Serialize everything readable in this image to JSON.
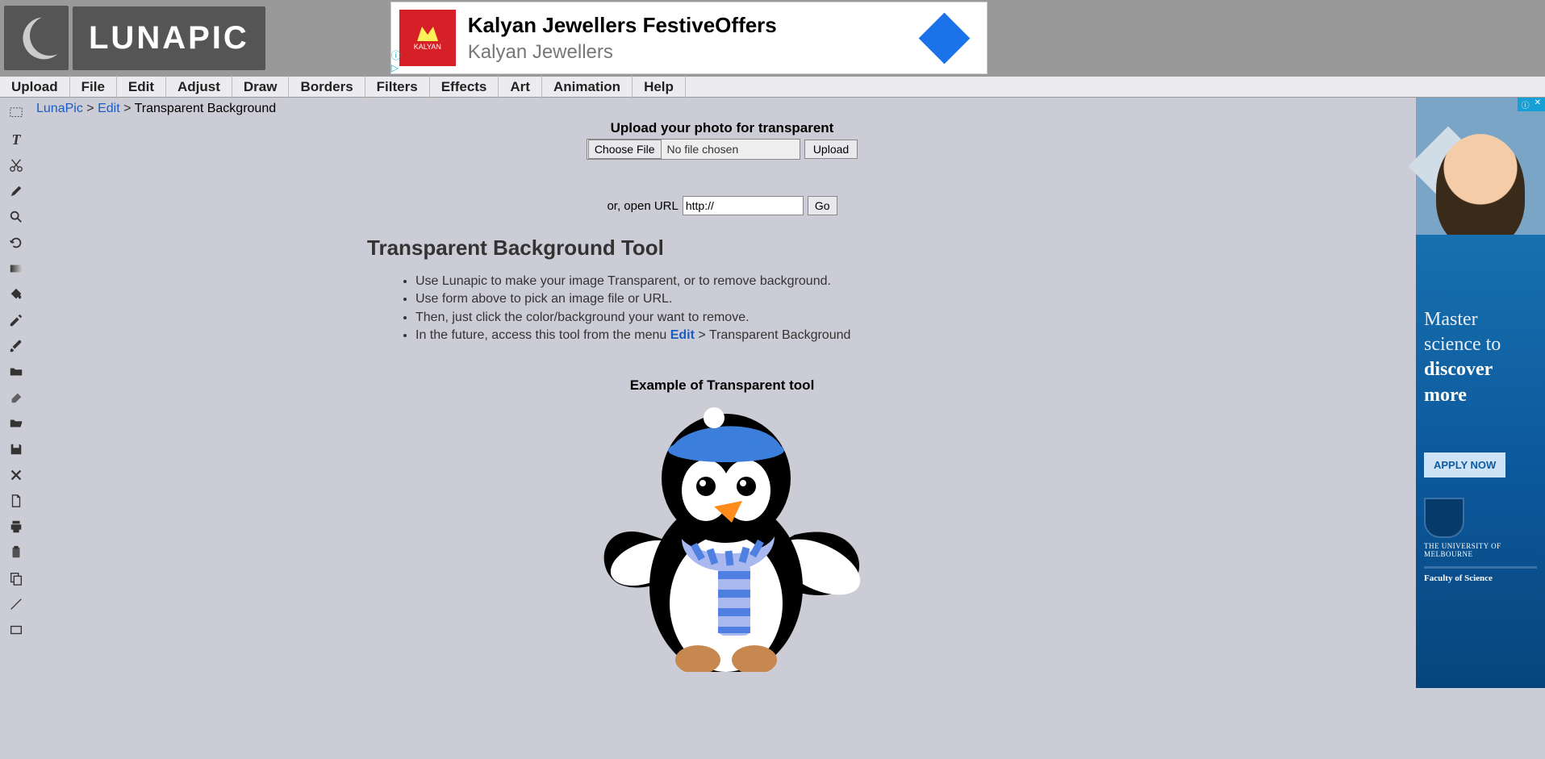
{
  "brand": "LUNAPIC",
  "ad_top": {
    "logo_text": "KALYAN",
    "title": "Kalyan Jewellers FestiveOffers",
    "subtitle": "Kalyan Jewellers"
  },
  "menubar": [
    "Upload",
    "File",
    "Edit",
    "Adjust",
    "Draw",
    "Borders",
    "Filters",
    "Effects",
    "Art",
    "Animation",
    "Help"
  ],
  "breadcrumb": {
    "home": "LunaPic",
    "edit": "Edit",
    "current": "Transparent Background",
    "sep": " > "
  },
  "upload": {
    "title": "Upload your photo for transparent",
    "choose_label": "Choose File",
    "no_file": "No file chosen",
    "upload_label": "Upload"
  },
  "url_section": {
    "label": "or, open URL",
    "value": "http://",
    "go_label": "Go"
  },
  "tool": {
    "heading": "Transparent Background Tool",
    "points": [
      "Use Lunapic to make your image Transparent, or to remove background.",
      "Use form above to pick an image file or URL.",
      "Then, just click the color/background your want to remove.",
      "In the future, access this tool from the menu "
    ],
    "edit_link": "Edit",
    "edit_suffix": " > Transparent Background"
  },
  "example_title": "Example of Transparent tool",
  "ad_right": {
    "line1": "Master science to ",
    "line2": "discover more",
    "button": "APPLY NOW",
    "uni": "THE UNIVERSITY OF MELBOURNE",
    "faculty": "Faculty of Science"
  },
  "sidebar_tools": [
    "select",
    "text",
    "cut",
    "pencil",
    "zoom",
    "rotate",
    "gradient",
    "fill",
    "eyedropper",
    "brush",
    "folder",
    "eraser",
    "open",
    "save",
    "close",
    "new-doc",
    "print",
    "clipboard",
    "copy",
    "line",
    "rectangle"
  ]
}
